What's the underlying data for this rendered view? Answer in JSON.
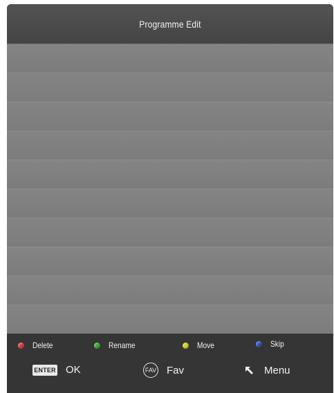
{
  "header": {
    "title": "Programme Edit"
  },
  "list": {
    "rows": [
      "",
      "",
      "",
      "",
      "",
      "",
      "",
      "",
      "",
      ""
    ]
  },
  "footer": {
    "color_keys": [
      {
        "label": "Delete",
        "icon": "red-dot-icon",
        "color": "#e03a3a"
      },
      {
        "label": "Rename",
        "icon": "green-dot-icon",
        "color": "#35b035"
      },
      {
        "label": "Move",
        "icon": "yellow-dot-icon",
        "color": "#d9d230"
      },
      {
        "label": "Skip",
        "icon": "blue-dot-icon",
        "color": "#2e55c8"
      }
    ],
    "nav_keys": [
      {
        "icon_text": "ENTER",
        "label": "OK",
        "icon": "enter-key-icon"
      },
      {
        "icon_text": "FAV",
        "label": "Fav",
        "icon": "fav-key-icon"
      },
      {
        "icon_text": "",
        "label": "Menu",
        "icon": "back-arrow-icon"
      }
    ]
  }
}
